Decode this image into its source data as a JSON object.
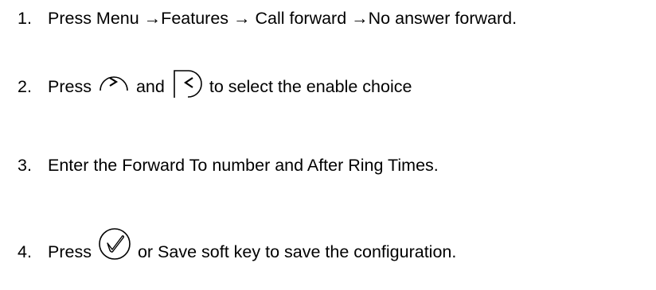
{
  "steps": [
    {
      "number": "1.",
      "text": "Press Menu →Features → Call forward →No answer forward."
    },
    {
      "number": "2.",
      "prefix": "Press",
      "middle": "and",
      "suffix": "to select the enable choice",
      "icons": [
        "right-navigation-key-icon",
        "left-navigation-key-icon"
      ]
    },
    {
      "number": "3.",
      "text": "Enter the Forward To number and After Ring Times."
    },
    {
      "number": "4.",
      "prefix": "Press",
      "suffix": "or Save soft key to save the configuration.",
      "icons": [
        "ok-key-icon"
      ]
    }
  ]
}
